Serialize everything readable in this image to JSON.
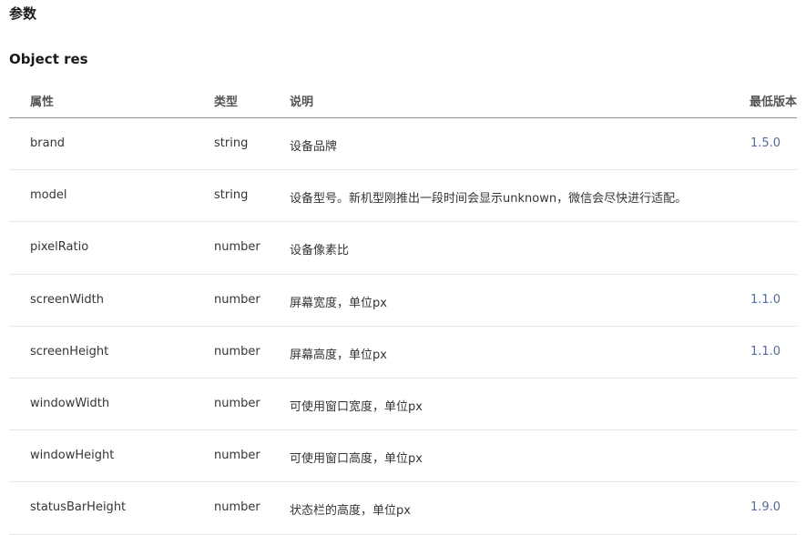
{
  "section": {
    "title": "参数"
  },
  "object": {
    "title": "Object res"
  },
  "table": {
    "headers": [
      "属性",
      "类型",
      "说明",
      "最低版本"
    ],
    "rows": [
      {
        "prop": "brand",
        "type": "string",
        "desc": "设备品牌",
        "version": "1.5.0"
      },
      {
        "prop": "model",
        "type": "string",
        "desc": "设备型号。新机型刚推出一段时间会显示unknown，微信会尽快进行适配。",
        "version": ""
      },
      {
        "prop": "pixelRatio",
        "type": "number",
        "desc": "设备像素比",
        "version": ""
      },
      {
        "prop": "screenWidth",
        "type": "number",
        "desc": "屏幕宽度，单位px",
        "version": "1.1.0"
      },
      {
        "prop": "screenHeight",
        "type": "number",
        "desc": "屏幕高度，单位px",
        "version": "1.1.0"
      },
      {
        "prop": "windowWidth",
        "type": "number",
        "desc": "可使用窗口宽度，单位px",
        "version": ""
      },
      {
        "prop": "windowHeight",
        "type": "number",
        "desc": "可使用窗口高度，单位px",
        "version": ""
      },
      {
        "prop": "statusBarHeight",
        "type": "number",
        "desc": "状态栏的高度，单位px",
        "version": "1.9.0"
      }
    ]
  }
}
